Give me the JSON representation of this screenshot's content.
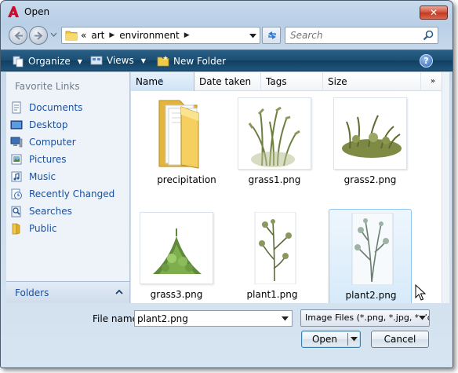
{
  "window": {
    "title": "Open"
  },
  "titlebar": {
    "close_symbol": "✕"
  },
  "address": {
    "crumbs": [
      "«",
      "art",
      "environment"
    ]
  },
  "search": {
    "placeholder": "Search"
  },
  "toolbar": {
    "organize": "Organize",
    "views": "Views",
    "new_folder": "New Folder",
    "help": "?"
  },
  "left_pane": {
    "favorite_links_title": "Favorite Links",
    "items": [
      {
        "label": "Documents",
        "icon": "documents-icon"
      },
      {
        "label": "Desktop",
        "icon": "desktop-icon"
      },
      {
        "label": "Computer",
        "icon": "computer-icon"
      },
      {
        "label": "Pictures",
        "icon": "pictures-icon"
      },
      {
        "label": "Music",
        "icon": "music-icon"
      },
      {
        "label": "Recently Changed",
        "icon": "recently-changed-icon"
      },
      {
        "label": "Searches",
        "icon": "searches-icon"
      },
      {
        "label": "Public",
        "icon": "public-folder-icon"
      }
    ],
    "folders_label": "Folders"
  },
  "columns": {
    "name": "Name",
    "date_taken": "Date taken",
    "tags": "Tags",
    "size": "Size",
    "more": "»"
  },
  "files": [
    {
      "name": "precipitation",
      "type": "folder"
    },
    {
      "name": "grass1.png",
      "type": "image"
    },
    {
      "name": "grass2.png",
      "type": "image"
    },
    {
      "name": "grass3.png",
      "type": "image"
    },
    {
      "name": "plant1.png",
      "type": "image"
    },
    {
      "name": "plant2.png",
      "type": "image",
      "selected": true
    }
  ],
  "bottom": {
    "file_name_label": "File name:",
    "file_name_value": "plant2.png",
    "file_type": "Image Files (*.png, *.jpg, *.dds",
    "open_button": "Open",
    "cancel_button": "Cancel"
  },
  "colors": {
    "toolbar_bg": "#1c4e73",
    "link_blue": "#1a4f9c",
    "selection_bg": "#d6eaf9",
    "close_red": "#c0381f"
  }
}
